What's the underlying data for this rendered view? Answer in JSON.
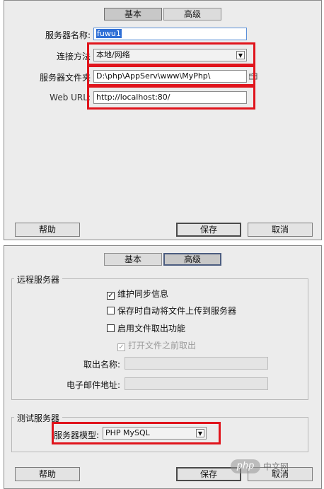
{
  "basic_panel": {
    "tabs": [
      "基本",
      "高级"
    ],
    "server_name_label": "服务器名称:",
    "server_name_value": "fuwu1",
    "connect_method_label": "连接方法",
    "connect_method_value": "本地/网络",
    "server_folder_label": "服务器文件夹",
    "server_folder_value": "D:\\php\\AppServ\\www\\MyPhp\\",
    "web_url_label": "Web URL:",
    "web_url_value": "http://localhost:80/",
    "help": "帮助",
    "save": "保存",
    "cancel": "取消"
  },
  "advanced_panel": {
    "tabs": [
      "基本",
      "高级"
    ],
    "remote_group_title": "远程服务器",
    "maintain_sync": "维护同步信息",
    "maintain_sync_checked": true,
    "auto_upload": "保存时自动将文件上传到服务器",
    "auto_upload_checked": false,
    "enable_checkout": "启用文件取出功能",
    "enable_checkout_checked": false,
    "open_before_checkout": "打开文件之前取出",
    "open_before_checkout_checked": true,
    "checkout_name_label": "取出名称:",
    "email_label": "电子邮件地址:",
    "testing_group_title": "测试服务器",
    "server_model_label": "服务器模型:",
    "server_model_value": "PHP MySQL",
    "help": "帮助",
    "save": "保存",
    "cancel": "取消"
  },
  "watermark": {
    "php": "php",
    "site": "中文网"
  },
  "colors": {
    "highlight_red": "#e0141c",
    "selection_blue": "#2f6fd6"
  }
}
